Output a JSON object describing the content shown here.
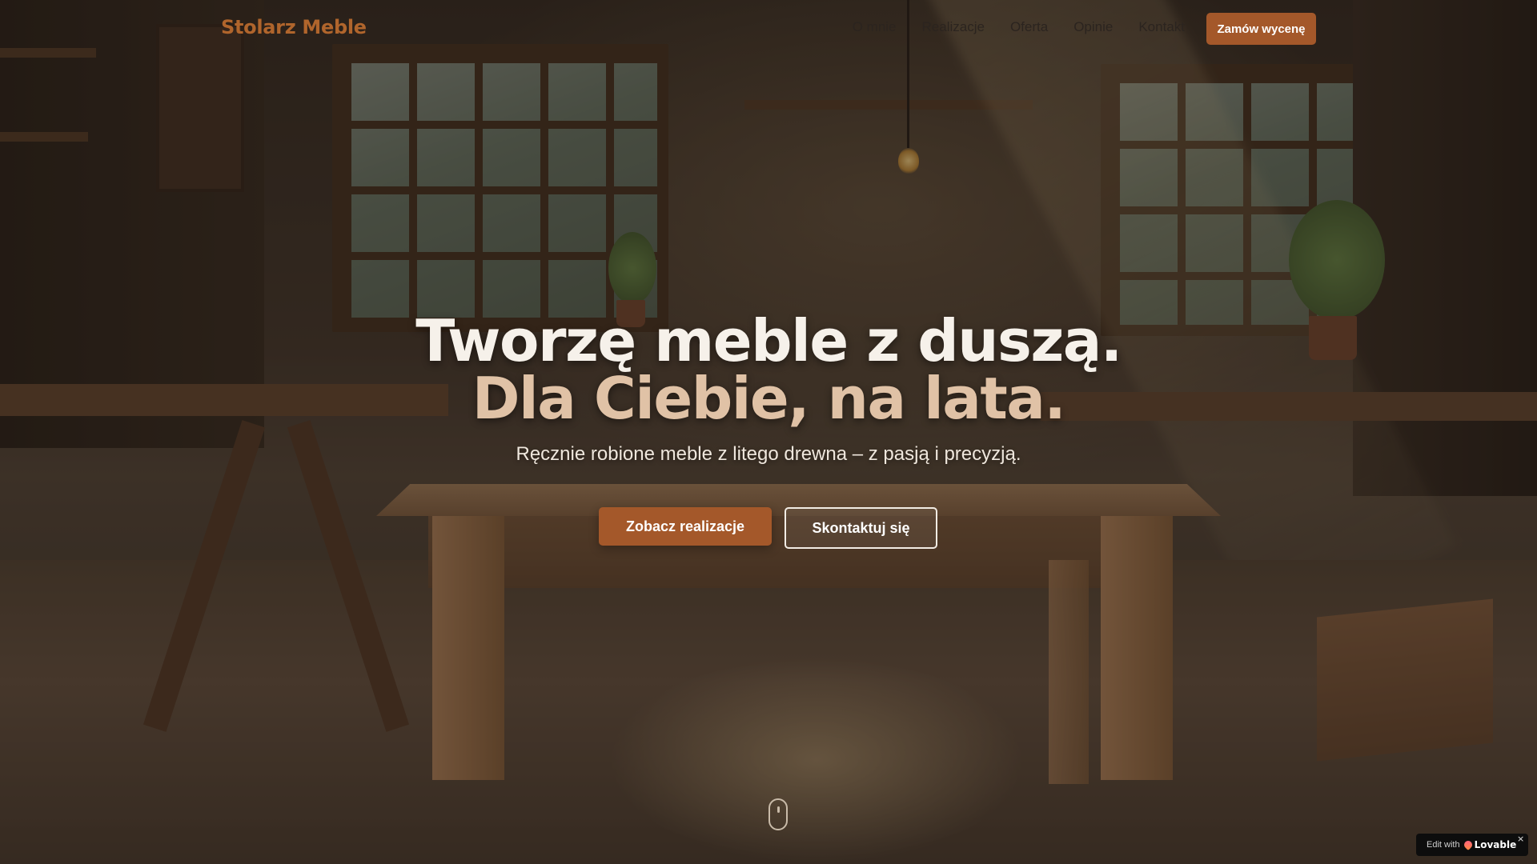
{
  "header": {
    "logo": "Stolarz Meble",
    "nav": [
      {
        "label": "O mnie"
      },
      {
        "label": "Realizacje"
      },
      {
        "label": "Oferta"
      },
      {
        "label": "Opinie"
      },
      {
        "label": "Kontakt"
      }
    ],
    "cta_label": "Zamów wycenę"
  },
  "hero": {
    "title_line1": "Tworzę meble z duszą.",
    "title_line2": "Dla Ciebie, na lata.",
    "subtitle": "Ręcznie robione meble z litego drewna – z pasją i precyzją.",
    "primary_button": "Zobacz realizacje",
    "secondary_button": "Skontaktuj się"
  },
  "badge": {
    "edit_text": "Edit with",
    "brand": "Lovable",
    "close": "×"
  },
  "colors": {
    "accent": "#a4582a",
    "logo": "#b0652c",
    "title_light": "#f6f1ea",
    "title_accent": "#e0c2a6"
  },
  "icons": {
    "scroll": "mouse-scroll-icon",
    "badge_logo": "lovable-heart-icon"
  }
}
